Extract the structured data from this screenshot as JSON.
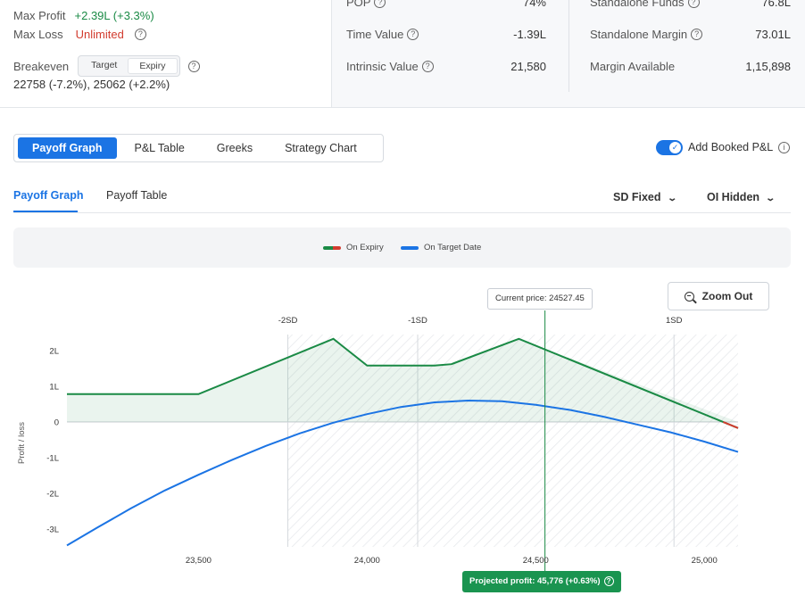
{
  "summary": {
    "max_profit_label": "Max Profit",
    "max_profit_value": "+2.39L (+3.3%)",
    "max_loss_label": "Max Loss",
    "max_loss_value": "Unlimited",
    "breakeven_label": "Breakeven",
    "breakeven_toggle": [
      "Target",
      "Expiry"
    ],
    "breakeven_values": "22758 (-7.2%), 25062 (+2.2%)",
    "pop_label": "POP",
    "pop_value": "74%",
    "time_value_label": "Time Value",
    "time_value": "-1.39L",
    "intrinsic_label": "Intrinsic Value",
    "intrinsic_value": "21,580",
    "standalone_funds_label": "Standalone Funds",
    "standalone_funds_value": "76.8L",
    "standalone_margin_label": "Standalone Margin",
    "standalone_margin_value": "73.01L",
    "margin_available_label": "Margin Available",
    "margin_available_value": "1,15,898"
  },
  "tabs": [
    "Payoff Graph",
    "P&L Table",
    "Greeks",
    "Strategy Chart"
  ],
  "add_booked_label": "Add Booked P&L",
  "sub_tabs": [
    "Payoff Graph",
    "Payoff Table"
  ],
  "dropdowns": {
    "sd": "SD Fixed",
    "oi": "OI Hidden"
  },
  "legend": [
    "On Expiry",
    "On Target Date"
  ],
  "zoom_label": "Zoom Out",
  "current_price_label": "Current price: 24527.45",
  "projected_label": "Projected profit: 45,776 (+0.63%)",
  "colors": {
    "accent": "#1b74e4",
    "profit": "#1a8a45",
    "loss": "#d23c2f"
  },
  "chart_data": {
    "type": "line",
    "ylabel": "Profit / loss",
    "x_ticks": [
      23500,
      24000,
      24500,
      25000
    ],
    "x_tick_labels": [
      "23,500",
      "24,000",
      "24,500",
      "25,000"
    ],
    "y_ticks": [
      2,
      1,
      0,
      -1,
      -2,
      -3
    ],
    "y_tick_labels": [
      "2L",
      "1L",
      "0",
      "-1L",
      "-2L",
      "-3L"
    ],
    "xlim": [
      23110,
      25100
    ],
    "ylim": [
      -3.5,
      2.45
    ],
    "sd_lines": [
      {
        "label": "-2SD",
        "x": 23765
      },
      {
        "label": "-1SD",
        "x": 24150
      },
      {
        "label": "1SD",
        "x": 24910
      }
    ],
    "current_price": 24527.45,
    "series": [
      {
        "name": "On Expiry",
        "x": [
          23110,
          23500,
          23900,
          24000,
          24200,
          24250,
          24450,
          25100
        ],
        "y": [
          0.78,
          0.78,
          2.33,
          1.58,
          1.58,
          1.62,
          2.33,
          -0.17
        ]
      },
      {
        "name": "On Target Date",
        "x": [
          23110,
          23200,
          23300,
          23400,
          23500,
          23600,
          23700,
          23800,
          23900,
          24000,
          24100,
          24200,
          24300,
          24400,
          24500,
          24600,
          24700,
          24800,
          24900,
          25000,
          25100
        ],
        "y": [
          -3.46,
          -2.96,
          -2.42,
          -1.92,
          -1.48,
          -1.06,
          -0.67,
          -0.32,
          -0.02,
          0.22,
          0.42,
          0.55,
          0.6,
          0.58,
          0.48,
          0.34,
          0.15,
          -0.07,
          -0.29,
          -0.55,
          -0.84
        ]
      }
    ]
  }
}
